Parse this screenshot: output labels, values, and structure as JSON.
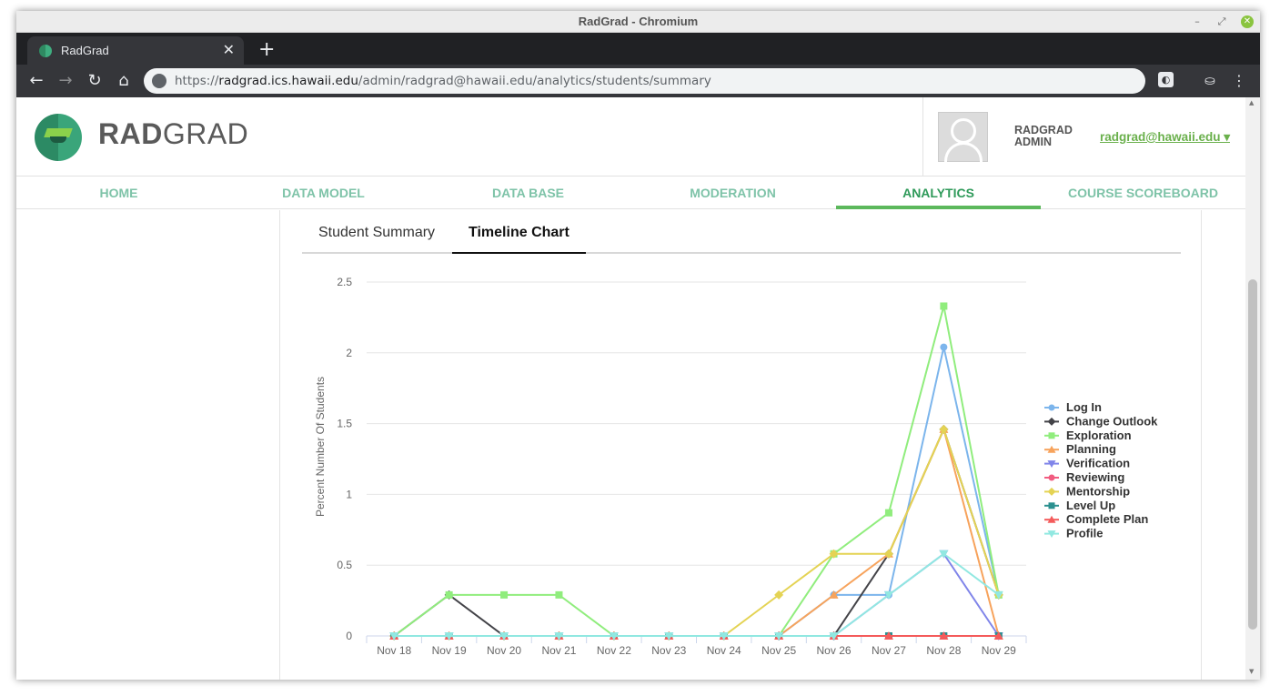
{
  "window": {
    "title": "RadGrad - Chromium"
  },
  "browser": {
    "tab_title": "RadGrad",
    "url_scheme": "https://",
    "url_host": "radgrad.ics.hawaii.edu",
    "url_path": "/admin/radgrad@hawaii.edu/analytics/students/summary"
  },
  "header": {
    "brand_bold": "RAD",
    "brand_rest": "GRAD",
    "user_name_line1": "RADGRAD",
    "user_name_line2": "ADMIN",
    "user_email": "radgrad@hawaii.edu ▾"
  },
  "nav": {
    "items": [
      {
        "label": "HOME"
      },
      {
        "label": "DATA MODEL"
      },
      {
        "label": "DATA BASE"
      },
      {
        "label": "MODERATION"
      },
      {
        "label": "ANALYTICS"
      },
      {
        "label": "COURSE SCOREBOARD"
      }
    ],
    "active": "ANALYTICS"
  },
  "content_tabs": [
    {
      "label": "Student Summary"
    },
    {
      "label": "Timeline Chart"
    }
  ],
  "active_content_tab": "Timeline Chart",
  "chart_data": {
    "type": "line",
    "title": "",
    "xlabel": "",
    "ylabel": "Percent Number Of Students",
    "ylim": [
      0,
      2.5
    ],
    "yticks": [
      "0",
      "0.5",
      "1",
      "1.5",
      "2",
      "2.5"
    ],
    "categories": [
      "Nov 18",
      "Nov 19",
      "Nov 20",
      "Nov 21",
      "Nov 22",
      "Nov 23",
      "Nov 24",
      "Nov 25",
      "Nov 26",
      "Nov 27",
      "Nov 28",
      "Nov 29"
    ],
    "grid": true,
    "legend_position": "right",
    "series": [
      {
        "name": "Log In",
        "color": "#7cb5ec",
        "marker": "circle",
        "values": [
          0,
          0,
          0,
          0,
          0,
          0,
          0,
          0,
          0.29,
          0.29,
          2.04,
          0.29
        ]
      },
      {
        "name": "Change Outlook",
        "color": "#434348",
        "marker": "diamond",
        "values": [
          0,
          0.29,
          0,
          0,
          0,
          0,
          0,
          0,
          0,
          0.58,
          1.46,
          0.29
        ]
      },
      {
        "name": "Exploration",
        "color": "#90ed7d",
        "marker": "square",
        "values": [
          0,
          0.29,
          0.29,
          0.29,
          0,
          0,
          0,
          0,
          0.58,
          0.87,
          2.33,
          0.29
        ]
      },
      {
        "name": "Planning",
        "color": "#f7a35c",
        "marker": "triangle",
        "values": [
          0,
          0,
          0,
          0,
          0,
          0,
          0,
          0,
          0.29,
          0.58,
          1.46,
          0
        ]
      },
      {
        "name": "Verification",
        "color": "#8085e9",
        "marker": "triangle-down",
        "values": [
          0,
          0,
          0,
          0,
          0,
          0,
          0,
          0,
          0,
          0.29,
          0.58,
          0
        ]
      },
      {
        "name": "Reviewing",
        "color": "#f15c80",
        "marker": "circle",
        "values": [
          0,
          0,
          0,
          0,
          0,
          0,
          0,
          0,
          0,
          0,
          0,
          0
        ]
      },
      {
        "name": "Mentorship",
        "color": "#e4d354",
        "marker": "diamond",
        "values": [
          0,
          0,
          0,
          0,
          0,
          0,
          0,
          0.29,
          0.58,
          0.58,
          1.46,
          0.29
        ]
      },
      {
        "name": "Level Up",
        "color": "#2b908f",
        "marker": "square",
        "values": [
          0,
          0,
          0,
          0,
          0,
          0,
          0,
          0,
          0,
          0,
          0,
          0
        ]
      },
      {
        "name": "Complete Plan",
        "color": "#f45b5b",
        "marker": "triangle",
        "values": [
          0,
          0,
          0,
          0,
          0,
          0,
          0,
          0,
          0,
          0,
          0,
          0
        ]
      },
      {
        "name": "Profile",
        "color": "#91e8e1",
        "marker": "triangle-down",
        "values": [
          0,
          0,
          0,
          0,
          0,
          0,
          0,
          0,
          0,
          0.29,
          0.58,
          0.29
        ]
      }
    ]
  }
}
